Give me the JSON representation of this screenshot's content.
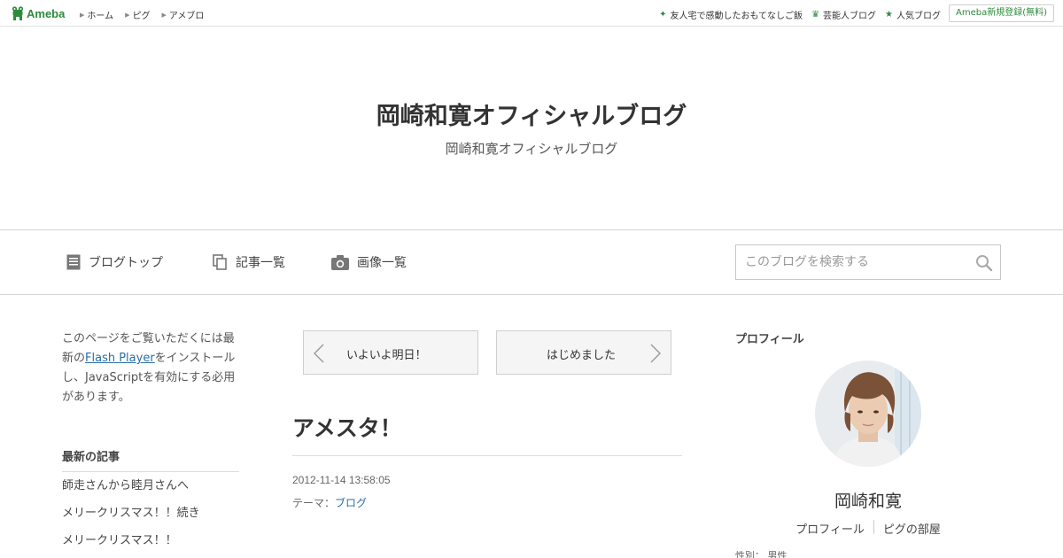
{
  "topbar": {
    "logo_text": "Ameba",
    "nav": [
      {
        "label": "ホーム"
      },
      {
        "label": "ピグ"
      },
      {
        "label": "アメブロ"
      }
    ],
    "links": [
      {
        "icon": "sparkle-icon",
        "label": "友人宅で感動したおもてなしご飯"
      },
      {
        "icon": "crown-icon",
        "label": "芸能人ブログ"
      },
      {
        "icon": "star-icon",
        "label": "人気ブログ"
      }
    ],
    "register_label": "Ameba新規登録(無料)"
  },
  "header": {
    "title": "岡崎和寛オフィシャルブログ",
    "description": "岡崎和寛オフィシャルブログ"
  },
  "gnav": {
    "items": [
      {
        "icon": "document-icon",
        "label": "ブログトップ"
      },
      {
        "icon": "copy-icon",
        "label": "記事一覧"
      },
      {
        "icon": "camera-icon",
        "label": "画像一覧"
      }
    ],
    "search_placeholder": "このブログを検索する"
  },
  "left": {
    "flash_before": "このページをご覧いただくには最新の",
    "flash_link": "Flash Player",
    "flash_after": "をインストールし、JavaScriptを有効にする必用があります。",
    "latest_heading": "最新の記事",
    "latest_items": [
      "師走さんから睦月さんへ",
      "メリークリスマス！！続き",
      "メリークリスマス！！"
    ]
  },
  "entry": {
    "prev_label": "いよいよ明日！",
    "next_label": "はじめました",
    "title": "アメスタ！",
    "date": "2012-11-14 13:58:05",
    "theme_prefix": "テーマ：",
    "theme_link": "ブログ"
  },
  "profile": {
    "heading": "プロフィール",
    "name": "岡崎和寛",
    "links": [
      "プロフィール",
      "ピグの部屋"
    ],
    "cut_text": "性別： 男性"
  },
  "colors": {
    "brand_green": "#2d8c3c",
    "link_blue": "#2a6ea6"
  }
}
